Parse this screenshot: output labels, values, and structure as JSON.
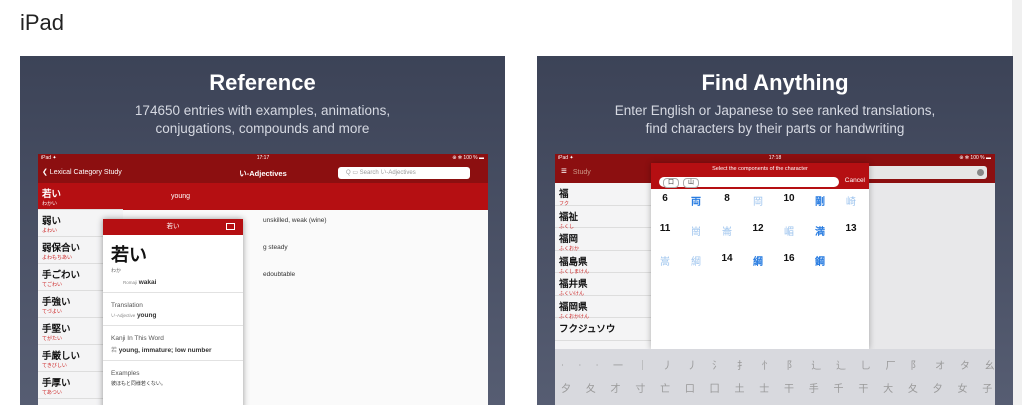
{
  "page_heading": "iPad",
  "cards": {
    "reference": {
      "title": "Reference",
      "subtitle_1": "174650 entries with examples, animations,",
      "subtitle_2": "conjugations, compounds and more",
      "screen": {
        "status_left": "iPad ✦",
        "status_time": "17:17",
        "status_right": "⊕ ✻ 100 % ▬",
        "back_label": "❮ Lexical Category Study",
        "nav_title": "い-Adjectives",
        "search_placeholder": "Q ▭ Search い-Adjectives",
        "selected_meaning": "young",
        "rows": [
          {
            "kanji": "若い",
            "reading": "わかい"
          },
          {
            "kanji": "弱い",
            "reading": "よわい"
          },
          {
            "kanji": "弱保合い",
            "reading": "よわもちあい"
          },
          {
            "kanji": "手ごわい",
            "reading": "てごわい"
          },
          {
            "kanji": "手強い",
            "reading": "てづよい"
          },
          {
            "kanji": "手堅い",
            "reading": "てがたい"
          },
          {
            "kanji": "手厳しい",
            "reading": "てきびしい"
          },
          {
            "kanji": "手厚い",
            "reading": "てあつい"
          }
        ],
        "defs": [
          "unskilled, weak (wine)",
          "g steady",
          "edoubtable"
        ],
        "popup": {
          "header": "若い",
          "word": "若い",
          "kana": "わか",
          "romaji_label": "Romaji",
          "romaji": "wakai",
          "translation_label": "Translation",
          "pos_label": "い-Adjective",
          "meaning": "young",
          "kanji_label": "Kanji In This Word",
          "kanji_entry": "若",
          "kanji_meaning": "young, immature; low number",
          "examples_label": "Examples",
          "example_text": "彼ほもと同様若くない。"
        }
      }
    },
    "find": {
      "title": "Find Anything",
      "subtitle_1": "Enter English or Japanese to see ranked translations,",
      "subtitle_2": "find characters by their parts or handwriting",
      "screen": {
        "status_left": "iPad ✦",
        "status_time": "17:18",
        "status_right": "⊕ ✻ 100 % ▬",
        "menu_icon": "≡",
        "menu_faint": "Study",
        "panel_title": "Select the components of the character",
        "chips": [
          "口",
          "山"
        ],
        "cancel_label": "Cancel",
        "list": [
          {
            "kanji": "福",
            "reading": "フク"
          },
          {
            "kanji": "福祉",
            "reading": "ふくし"
          },
          {
            "kanji": "福岡",
            "reading": "ふくおか"
          },
          {
            "kanji": "福島県",
            "reading": "ふくしまけん"
          },
          {
            "kanji": "福井県",
            "reading": "ふくいけん"
          },
          {
            "kanji": "福岡県",
            "reading": "ふくおかけん"
          },
          {
            "kanji": "フクジュソウ",
            "reading": ""
          }
        ],
        "grid": {
          "row1": [
            "6",
            "両",
            "8",
            "岡",
            "10",
            "剛",
            "崎"
          ],
          "row2": [
            "11",
            "崗",
            "崙",
            "12",
            "嵋",
            "満",
            "13"
          ],
          "row3": [
            "嵩",
            "綱",
            "14",
            "綱",
            "16",
            "鋼"
          ]
        },
        "keyboard_row1": "ᐧ ᐧ ᐧ 一 ｜ 丿 丿 氵 扌 忄 阝 辶 辶 乚 厂 阝 オ タ 幺 ヨ 万 丈 上",
        "keyboard_row2": "夕 夂 才 寸 亡 口 囗 土 士 干 手 千 干 大 夂 夕 女 子 寸 小 大 尸"
      }
    }
  }
}
